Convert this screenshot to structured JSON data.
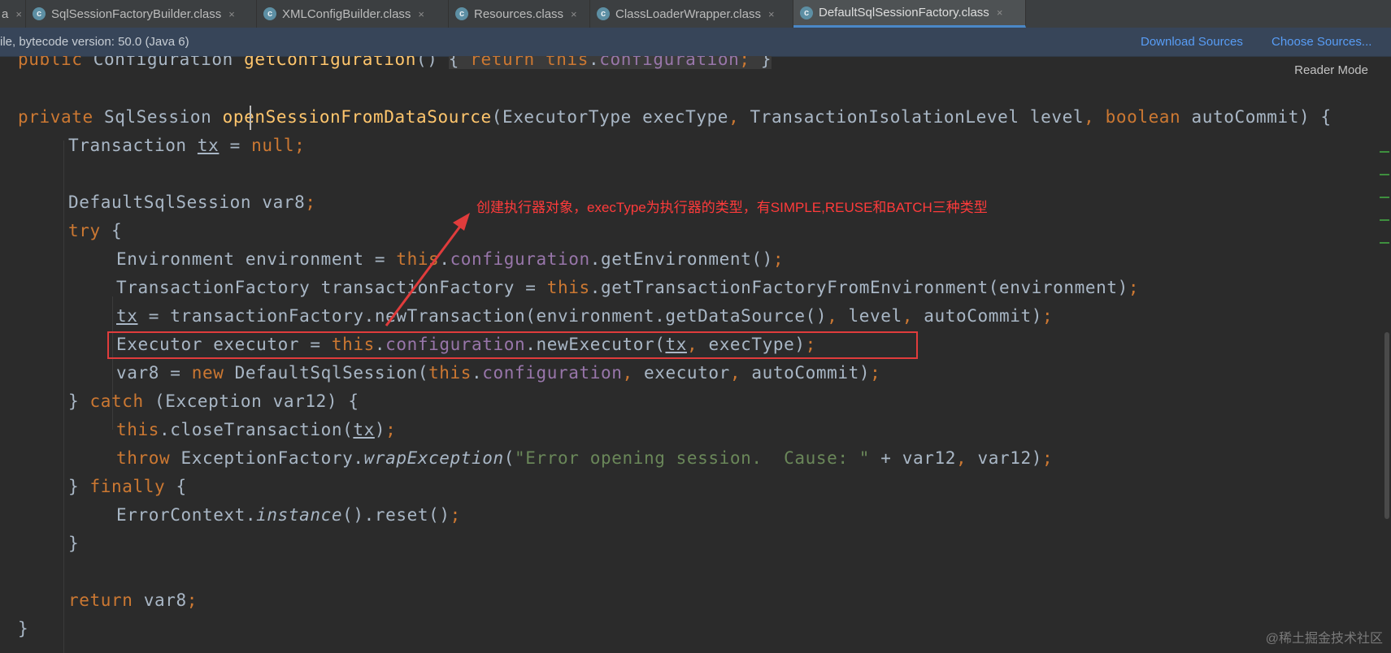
{
  "tabs": [
    {
      "label": "a",
      "active": false
    },
    {
      "label": "SqlSessionFactoryBuilder.class",
      "active": false
    },
    {
      "label": "XMLConfigBuilder.class",
      "active": false
    },
    {
      "label": "Resources.class",
      "active": false
    },
    {
      "label": "ClassLoaderWrapper.class",
      "active": false
    },
    {
      "label": "DefaultSqlSessionFactory.class",
      "active": true
    }
  ],
  "tab_close_glyph": "×",
  "tab_icon_letter": "c",
  "notice": {
    "message": "ile, bytecode version: 50.0 (Java 6)",
    "download_sources": "Download Sources",
    "choose_sources": "Choose Sources..."
  },
  "reader_mode": "Reader Mode",
  "annotation": "创建执行器对象，execType为执行器的类型，有SIMPLE,REUSE和BATCH三种类型",
  "watermark": "@稀土掘金技术社区",
  "colors": {
    "keyword": "#cc7832",
    "field": "#9876aa",
    "method_decl": "#ffc66d",
    "string": "#6a8759",
    "annotation_red": "#e03c3c",
    "link": "#589df6"
  },
  "code": {
    "l0": {
      "kw1": "public",
      "t1": " Configuration ",
      "fn": "getConfiguration",
      "t2": "() ",
      "b1": "{",
      "t3": " ",
      "kw2": "return",
      "t4": " ",
      "kw3": "this",
      "t5": ".",
      "f1": "configuration",
      "p1": ";",
      "t6": " ",
      "b2": "}"
    },
    "l1": {
      "kw1": "private",
      "t1": " SqlSession ",
      "fn": "openSessionFromDataSource",
      "t2": "(ExecutorType execType",
      "c1": ",",
      "t3": " TransactionIsolationLevel level",
      "c2": ",",
      "t4": " ",
      "kw2": "boolean",
      "t5": " autoCommit) {"
    },
    "l2": {
      "t1": "Transaction ",
      "u1": "tx",
      "t2": " = ",
      "kw1": "null",
      "p1": ";"
    },
    "l3": {
      "t1": "DefaultSqlSession var8",
      "p1": ";"
    },
    "l4": {
      "kw1": "try",
      "t1": " {"
    },
    "l5": {
      "t1": "Environment environment = ",
      "kw1": "this",
      "t2": ".",
      "f1": "configuration",
      "t3": ".getEnvironment()",
      "p1": ";"
    },
    "l6": {
      "t1": "TransactionFactory transactionFactory = ",
      "kw1": "this",
      "t2": ".getTransactionFactoryFromEnvironment(environment)",
      "p1": ";"
    },
    "l7": {
      "u1": "tx",
      "t1": " = transactionFactory.newTransaction(environment.getDataSource()",
      "c1": ",",
      "t2": " level",
      "c2": ",",
      "t3": " autoCommit)",
      "p1": ";"
    },
    "l8": {
      "t1": "Executor executor = ",
      "kw1": "this",
      "t2": ".",
      "f1": "configuration",
      "t3": ".newExecutor(",
      "u1": "tx",
      "c1": ",",
      "t4": " execType)",
      "p1": ";"
    },
    "l9": {
      "t1": "var8 = ",
      "kw1": "new",
      "t2": " DefaultSqlSession(",
      "kw2": "this",
      "t3": ".",
      "f1": "configuration",
      "c1": ",",
      "t4": " executor",
      "c2": ",",
      "t5": " autoCommit)",
      "p1": ";"
    },
    "l10": {
      "t1": "} ",
      "kw1": "catch",
      "t2": " (Exception var12) {"
    },
    "l11": {
      "kw1": "this",
      "t1": ".closeTransaction(",
      "u1": "tx",
      "t2": ")",
      "p1": ";"
    },
    "l12": {
      "kw1": "throw",
      "t1": " ExceptionFactory.",
      "i1": "wrapException",
      "t2": "(",
      "s1": "\"Error opening session.  Cause: \"",
      "t3": " + var12",
      "c1": ",",
      "t4": " var12)",
      "p1": ";"
    },
    "l13": {
      "t1": "} ",
      "kw1": "finally",
      "t2": " {"
    },
    "l14": {
      "t1": "ErrorContext.",
      "i1": "instance",
      "t2": "().reset()",
      "p1": ";"
    },
    "l15": {
      "t1": "}"
    },
    "l16": {
      "kw1": "return",
      "t1": " var8",
      "p1": ";"
    },
    "l17": {
      "t1": "}"
    }
  }
}
